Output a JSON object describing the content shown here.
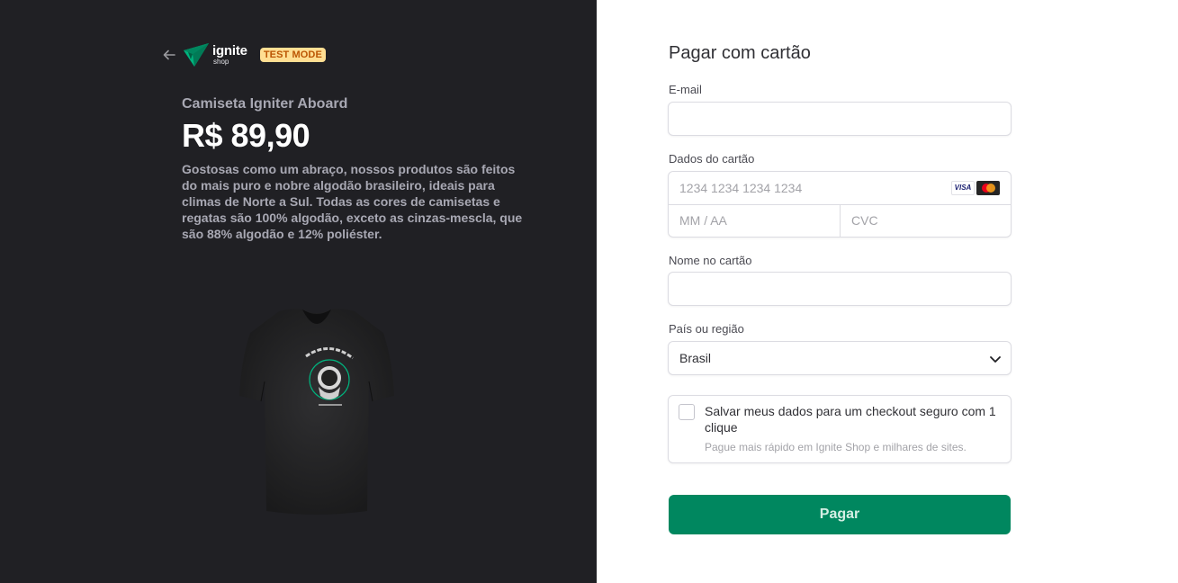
{
  "brand": {
    "name": "ignite",
    "sub": "shop",
    "test_badge": "TEST MODE"
  },
  "product": {
    "name": "Camiseta Igniter Aboard",
    "price": "R$ 89,90",
    "description": "Gostosas como um abraço, nossos produtos são feitos do mais puro e nobre algodão brasileiro, ideais para climas de Norte a Sul. Todas as cores de camisetas e regatas são 100% algodão, exceto as cinzas-mescla, que são 88% algodão e 12% poliéster.",
    "image_icon": "tshirt-image"
  },
  "form": {
    "title": "Pagar com cartão",
    "email_label": "E-mail",
    "email_value": "",
    "card_label": "Dados do cartão",
    "card_number_placeholder": "1234 1234 1234 1234",
    "card_expiry_placeholder": "MM / AA",
    "card_cvc_placeholder": "CVC",
    "card_brands": [
      "VISA",
      "mastercard"
    ],
    "name_label": "Nome no cartão",
    "name_value": "",
    "country_label": "País ou região",
    "country_value": "Brasil",
    "save_label": "Salvar meus dados para um checkout seguro com 1 clique",
    "save_sub": "Pague mais rápido em Ignite Shop e milhares de sites.",
    "save_checked": false,
    "pay_button": "Pagar"
  },
  "colors": {
    "left_bg": "#202024",
    "accent": "#00875f",
    "badge_bg": "#ffde92",
    "badge_text": "#bb5504"
  }
}
